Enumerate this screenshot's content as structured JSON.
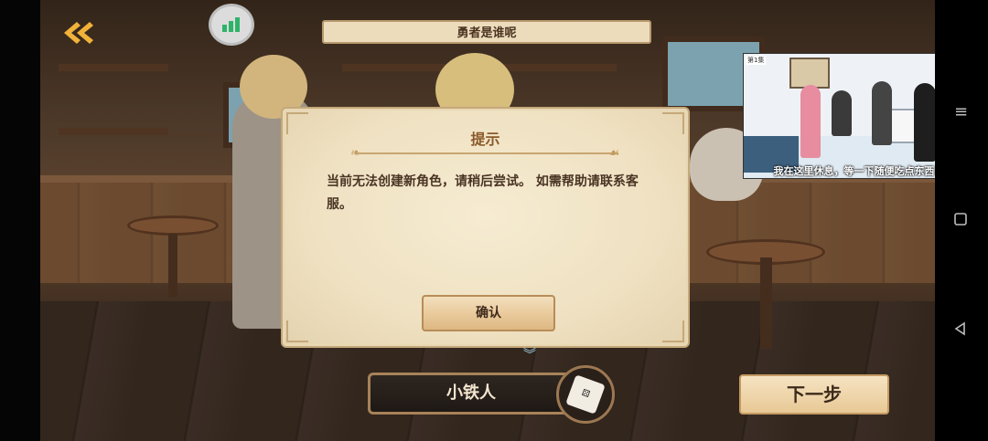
{
  "header": {
    "title": "勇者是谁呢"
  },
  "dialog": {
    "title": "提示",
    "message": "当前无法创建新角色，请稍后尝试。 如需帮助请联系客服。",
    "confirm_label": "确认"
  },
  "character": {
    "name": "小铁人"
  },
  "next_label": "下一步",
  "video": {
    "badge": "第1集",
    "caption": "我在这里休息，等一下随便吃点东西"
  },
  "icons": {
    "back": "back-arrow-icon",
    "signal": "signal-strength-icon",
    "dice": "dice-icon",
    "menu": "menu-icon",
    "home": "home-square-icon",
    "nav_back": "back-triangle-icon"
  }
}
